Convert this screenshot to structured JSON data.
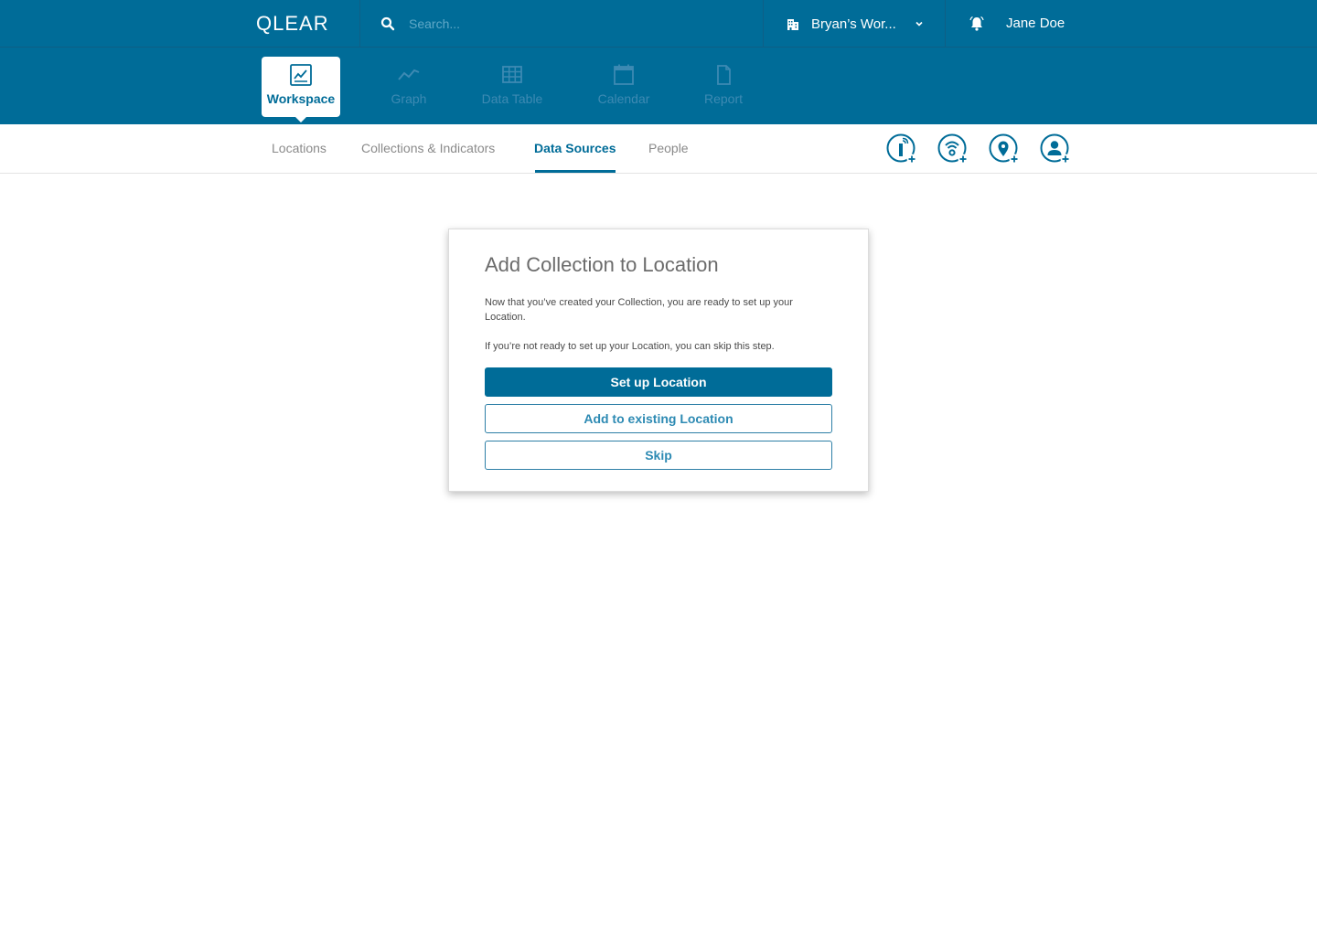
{
  "header": {
    "logo": "QLEAR",
    "search_placeholder": "Search...",
    "workspace": "Bryan’s Wor...",
    "user": "Jane Doe"
  },
  "modules": [
    {
      "label": "Workspace",
      "icon": "workspace-chart-icon",
      "active": true
    },
    {
      "label": "Graph",
      "icon": "graph-line-icon"
    },
    {
      "label": "Data Table",
      "icon": "table-grid-icon"
    },
    {
      "label": "Calendar",
      "icon": "calendar-icon"
    },
    {
      "label": "Report",
      "icon": "document-icon"
    }
  ],
  "subnav": {
    "tabs": [
      "Locations",
      "Collections & Indicators",
      "Data Sources",
      "People"
    ],
    "active": "Data Sources",
    "actions": [
      "add-sensor-icon",
      "add-data-source-icon",
      "add-location-icon",
      "add-person-icon"
    ]
  },
  "dialog": {
    "title": "Add Collection to Location",
    "p1": "Now that you’ve created your Collection, you are ready to set up your Location.",
    "p2": "If you’re not ready to set up your Location, you can skip this step.",
    "primary": "Set up Location",
    "secondary": "Add to existing Location",
    "skip": "Skip"
  },
  "colors": {
    "brand": "#006c98",
    "inactive_module": "#3d8ab3",
    "subnav_inactive": "#8a8a8a"
  }
}
